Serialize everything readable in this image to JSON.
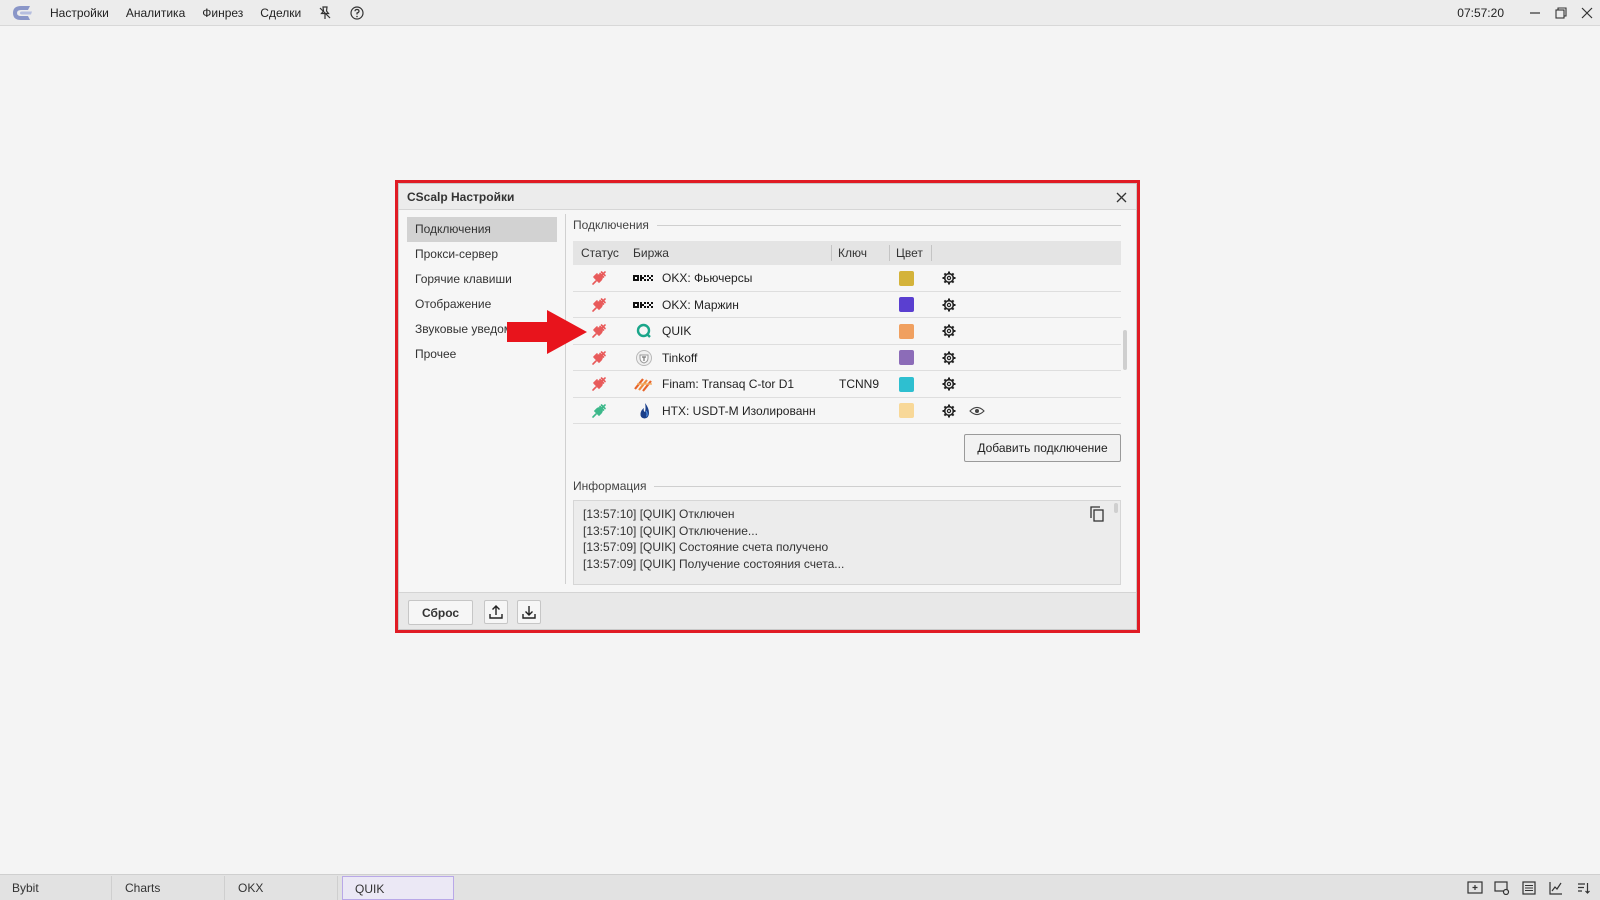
{
  "menu": {
    "items": [
      "Настройки",
      "Аналитика",
      "Финрез",
      "Сделки"
    ]
  },
  "topbar": {
    "clock": "07:57:20"
  },
  "dialog": {
    "title": "CScalp Настройки",
    "nav": [
      {
        "label": "Подключения",
        "active": true
      },
      {
        "label": "Прокси-сервер"
      },
      {
        "label": "Горячие клавиши"
      },
      {
        "label": "Отображение"
      },
      {
        "label": "Звуковые уведом"
      },
      {
        "label": "Прочее"
      }
    ],
    "connections_label": "Подключения",
    "columns": {
      "status": "Статус",
      "exchange": "Биржа",
      "key": "Ключ",
      "color": "Цвет"
    },
    "rows": [
      {
        "status": "disconnected",
        "icon": "okx-logo",
        "name": "OKX: Фьючерсы",
        "key": "",
        "color": "#d4b33a"
      },
      {
        "status": "disconnected",
        "icon": "okx-logo",
        "name": "OKX: Маржин",
        "key": "",
        "color": "#5a3fd0"
      },
      {
        "status": "disconnected",
        "icon": "quik-logo",
        "name": "QUIK",
        "key": "",
        "color": "#f0a060"
      },
      {
        "status": "disconnected",
        "icon": "tinkoff-logo",
        "name": "Tinkoff",
        "key": "",
        "color": "#8c6cb8"
      },
      {
        "status": "disconnected",
        "icon": "finam-logo",
        "name": "Finam: Transaq C-tor D1",
        "key": "TCNN9",
        "color": "#2ebfd0"
      },
      {
        "status": "connected",
        "icon": "htx-logo",
        "name": "HTX: USDT-M Изолированн",
        "key": "",
        "color": "#f8d898"
      }
    ],
    "add_button": "Добавить подключение",
    "info_label": "Информация",
    "log": [
      "[13:57:10] [QUIK] Отключен",
      "[13:57:10] [QUIK] Отключение...",
      "[13:57:09] [QUIK] Состояние счета получено",
      "[13:57:09] [QUIK] Получение состояния счета..."
    ],
    "reset_button": "Сброс"
  },
  "bottom_tabs": [
    {
      "label": "Bybit"
    },
    {
      "label": "Charts"
    },
    {
      "label": "OKX"
    },
    {
      "label": "QUIK",
      "active": true
    }
  ],
  "colors": {
    "highlight": "#e01b24",
    "disconnected": "#e85a5a",
    "connected": "#3cb88a",
    "arrow": "#e8141c"
  }
}
